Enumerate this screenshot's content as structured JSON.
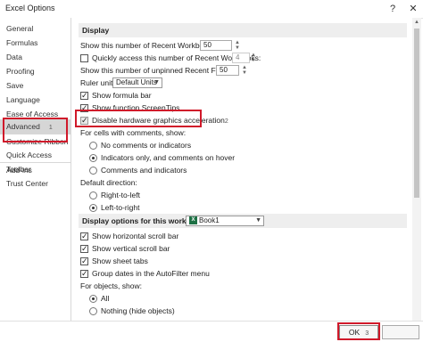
{
  "window": {
    "title": "Excel Options",
    "help_icon": "question-mark",
    "close_icon": "close-x"
  },
  "sidebar": {
    "items": [
      {
        "label": "General"
      },
      {
        "label": "Formulas"
      },
      {
        "label": "Data"
      },
      {
        "label": "Proofing"
      },
      {
        "label": "Save"
      },
      {
        "label": "Language"
      },
      {
        "label": "Ease of Access"
      },
      {
        "label": "Advanced",
        "step": "1"
      },
      {
        "label": "Customize Ribbon"
      },
      {
        "label": "Quick Access Toolbar"
      },
      {
        "label": "Add-ins"
      },
      {
        "label": "Trust Center"
      }
    ]
  },
  "display": {
    "header": "Display",
    "recent_workbooks_label": "Show this number of Recent Workbooks:",
    "recent_workbooks_value": "50",
    "quick_access_label": "Quickly access this number of Recent Workbooks:",
    "quick_access_value": "4",
    "unpinned_folders_label": "Show this number of unpinned Recent Folders:",
    "unpinned_folders_value": "50",
    "ruler_units_label": "Ruler units",
    "ruler_units_value": "Default Units",
    "show_formula_bar": "Show formula bar",
    "show_function_screentips": "Show function ScreenTips",
    "disable_hw_accel": "Disable hardware graphics acceleration",
    "disable_hw_accel_step": "2",
    "comments_group_label": "For cells with comments, show:",
    "comments_opt_none": "No comments or indicators",
    "comments_opt_indicators": "Indicators only, and comments on hover",
    "comments_opt_both": "Comments and indicators",
    "direction_label": "Default direction:",
    "direction_rtl": "Right-to-left",
    "direction_ltr": "Left-to-right"
  },
  "workbook": {
    "header": "Display options for this workbook:",
    "workbook_name": "Book1",
    "show_hscroll": "Show horizontal scroll bar",
    "show_vscroll": "Show vertical scroll bar",
    "show_sheet_tabs": "Show sheet tabs",
    "group_dates": "Group dates in the AutoFilter menu",
    "objects_label": "For objects, show:",
    "objects_all": "All",
    "objects_nothing": "Nothing (hide objects)"
  },
  "footer": {
    "ok_label": "OK",
    "ok_step": "3"
  },
  "colors": {
    "highlight": "#d0192a",
    "excel_green": "#1e7145",
    "active_item": "#d6d6d6"
  }
}
